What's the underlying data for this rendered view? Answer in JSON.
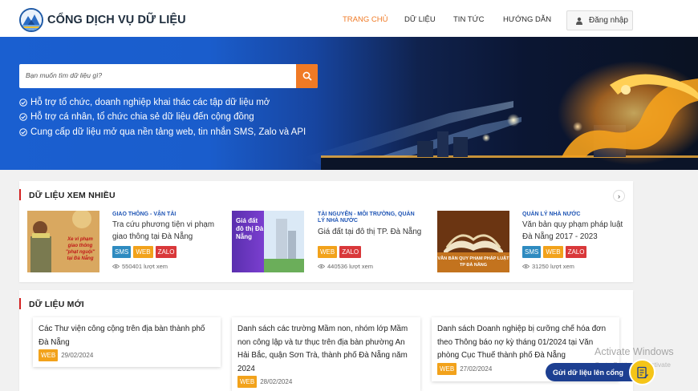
{
  "header": {
    "site_title": "CỔNG DỊCH VỤ DỮ LIỆU",
    "nav": [
      {
        "label": "TRANG CHỦ",
        "active": true
      },
      {
        "label": "DỮ LIỆU",
        "active": false
      },
      {
        "label": "TIN TỨC",
        "active": false
      },
      {
        "label": "HƯỚNG DẪN",
        "active": false
      }
    ],
    "login_label": "Đăng nhập"
  },
  "banner": {
    "search_placeholder": "Bạn muốn tìm dữ liệu gì?",
    "features": [
      "Hỗ trợ tổ chức, doanh nghiệp khai thác các tập dữ liệu mở",
      "Hỗ trợ cá nhân, tổ chức chia sẻ dữ liệu đến cộng đồng",
      "Cung cấp dữ liệu mở qua nền tảng web, tin nhắn SMS, Zalo và API"
    ]
  },
  "popular": {
    "title": "DỮ LIỆU XEM NHIỀU",
    "items": [
      {
        "category": "GIAO THÔNG - VẬN TẢI",
        "title": "Tra cứu phương tiện vi phạm giao thông tại Đà Nẵng",
        "tags": [
          "SMS",
          "WEB",
          "ZALO"
        ],
        "views": "550401 lượt xem",
        "thumb_text": "Xe vi phạm giao thông \"phạt nguội\" tại Đà Nẵng"
      },
      {
        "category": "TÀI NGUYÊN - MÔI TRƯỜNG, QUẢN LÝ NHÀ NƯỚC",
        "title": "Giá đất tại đô thị TP. Đà Nẵng",
        "tags": [
          "WEB",
          "ZALO"
        ],
        "views": "440536 lượt xem",
        "thumb_text": "Giá đất đô thị Đà Nẵng"
      },
      {
        "category": "QUẢN LÝ NHÀ NƯỚC",
        "title": "Văn bản quy phạm pháp luật Đà Nẵng 2017 - 2023",
        "tags": [
          "SMS",
          "WEB",
          "ZALO"
        ],
        "views": "31250 lượt xem",
        "thumb_text": "VĂN BẢN QUY PHẠM PHÁP LUẬT TP ĐÀ NẴNG"
      }
    ]
  },
  "latest": {
    "title": "DỮ LIỆU MỚI",
    "items": [
      {
        "title": "Các Thư viện công cộng trên địa bàn thành phố Đà Nẵng",
        "tag": "WEB",
        "date": "29/02/2024"
      },
      {
        "title": "Danh sách các trường Mầm non, nhóm lớp Mầm non công lập và tư thục trên địa bàn phường An Hải Bắc, quận Sơn Trà, thành phố Đà Nẵng năm 2024",
        "tag": "WEB",
        "date": "28/02/2024"
      },
      {
        "title": "Danh sách Doanh nghiệp bị cưỡng chế hóa đơn theo Thông báo nợ kỳ tháng 01/2024 tại Văn phòng Cục Thuế thành phố Đà Nẵng",
        "tag": "WEB",
        "date": "27/02/2024"
      }
    ]
  },
  "overlay": {
    "watermark_title": "Activate Windows",
    "watermark_sub": "Go to Settings to activate Windows.",
    "submit_label": "Gửi dữ liệu lên cổng"
  },
  "colors": {
    "accent": "#f07a25",
    "brand_blue": "#1a5fd0",
    "section_bar": "#d32222",
    "tag_sms": "#2e8bc0",
    "tag_web": "#f2a21b",
    "tag_zalo": "#d9383a"
  },
  "icons": {
    "login": "user-icon",
    "search": "search-icon",
    "feature": "check-circle-icon",
    "next": "chevron-right-icon",
    "views": "eye-icon",
    "submit": "document-upload-icon"
  }
}
